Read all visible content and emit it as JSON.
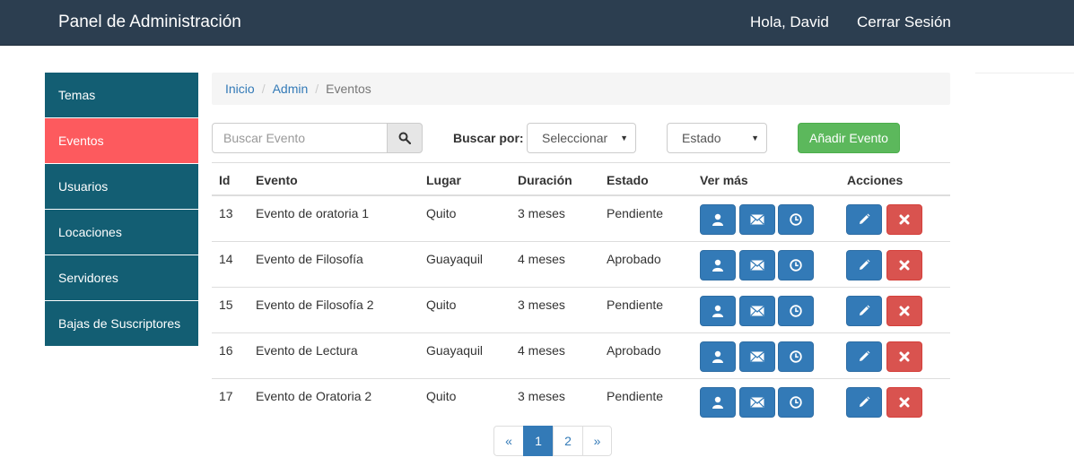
{
  "navbar": {
    "brand": "Panel de Administración",
    "greeting": "Hola, David",
    "logout": "Cerrar Sesión"
  },
  "sidebar": {
    "items": [
      {
        "label": "Temas"
      },
      {
        "label": "Eventos",
        "active": true
      },
      {
        "label": "Usuarios"
      },
      {
        "label": "Locaciones"
      },
      {
        "label": "Servidores"
      },
      {
        "label": "Bajas de Suscriptores"
      }
    ]
  },
  "breadcrumb": {
    "items": [
      "Inicio",
      "Admin",
      "Eventos"
    ],
    "separator": "/"
  },
  "toolbar": {
    "search_placeholder": "Buscar Evento",
    "search_icon": "search-icon",
    "filter_label": "Buscar por:",
    "filter_select": "Seleccionar",
    "status_select": "Estado",
    "caret": "▼",
    "add_label": "Añadir Evento"
  },
  "table": {
    "headers": {
      "id": "Id",
      "evento": "Evento",
      "lugar": "Lugar",
      "duracion": "Duración",
      "estado": "Estado",
      "ver_mas": "Ver más",
      "acciones": "Acciones"
    },
    "rows": [
      {
        "id": "13",
        "evento": "Evento de oratoria 1",
        "lugar": "Quito",
        "duracion": "3 meses",
        "estado": "Pendiente"
      },
      {
        "id": "14",
        "evento": "Evento de Filosofía",
        "lugar": "Guayaquil",
        "duracion": "4 meses",
        "estado": "Aprobado"
      },
      {
        "id": "15",
        "evento": "Evento de Filosofía 2",
        "lugar": "Quito",
        "duracion": "3 meses",
        "estado": "Pendiente"
      },
      {
        "id": "16",
        "evento": "Evento de Lectura",
        "lugar": "Guayaquil",
        "duracion": "4 meses",
        "estado": "Aprobado"
      },
      {
        "id": "17",
        "evento": "Evento de Oratoria 2",
        "lugar": "Quito",
        "duracion": "3 meses",
        "estado": "Pendiente"
      }
    ],
    "row_icons": [
      "user-icon",
      "envelope-icon",
      "clock-icon",
      "pencil-icon",
      "remove-icon"
    ]
  },
  "pagination": {
    "prev": "«",
    "pages": [
      "1",
      "2"
    ],
    "active_page": "1",
    "next": "»"
  },
  "colors": {
    "navbar": "#2c3e50",
    "sidebar": "#135e73",
    "sidebar_active": "#fd5a5e",
    "primary": "#337ab7",
    "danger": "#d9534f",
    "success": "#5cb85c"
  }
}
